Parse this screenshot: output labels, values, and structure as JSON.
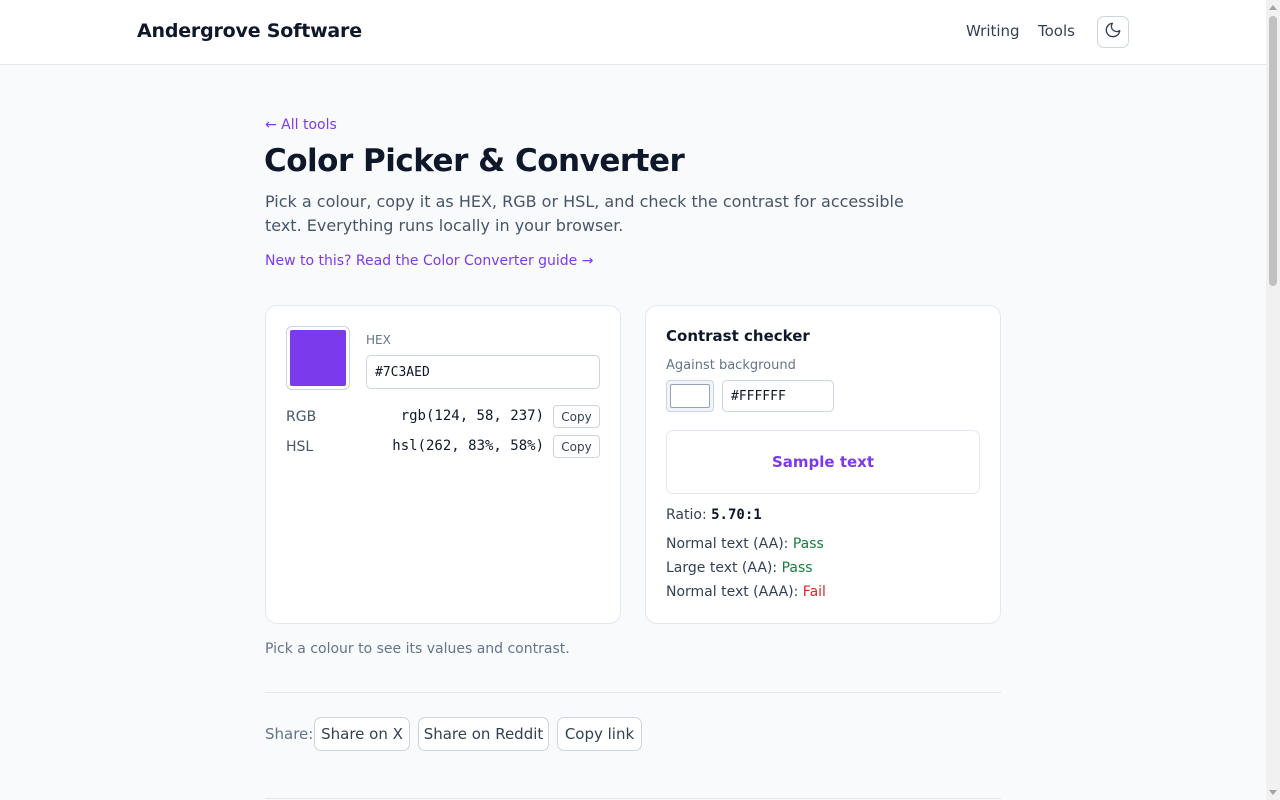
{
  "header": {
    "brand": "Andergrove Software",
    "nav": [
      "Writing",
      "Tools"
    ],
    "theme_toggle_icon": "moon-icon"
  },
  "page": {
    "back_link": "← All tools",
    "title": "Color Picker & Converter",
    "intro": "Pick a colour, copy it as HEX, RGB or HSL, and check the contrast for accessible text. Everything runs locally in your browser.",
    "guide_link": "New to this? Read the Color Converter guide →"
  },
  "picker": {
    "color": "#7C3AED",
    "hex_label": "HEX",
    "hex_value": "#7C3AED",
    "rgb_label": "RGB",
    "rgb_value": "rgb(124, 58, 237)",
    "hsl_label": "HSL",
    "hsl_value": "hsl(262, 83%, 58%)",
    "copy_label": "Copy"
  },
  "contrast": {
    "title": "Contrast checker",
    "against_label": "Against background",
    "bg_value": "#FFFFFF",
    "bg_color": "#FFFFFF",
    "sample_text": "Sample text",
    "ratio_label": "Ratio:",
    "ratio_value": "5.70:1",
    "checks": [
      {
        "label": "Normal text (AA):",
        "result": "Pass"
      },
      {
        "label": "Large text (AA):",
        "result": "Pass"
      },
      {
        "label": "Normal text (AAA):",
        "result": "Fail"
      }
    ]
  },
  "hint": "Pick a colour to see its values and contrast.",
  "share": {
    "label": "Share:",
    "buttons": [
      "Share on X",
      "Share on Reddit",
      "Copy link"
    ]
  },
  "colors": {
    "accent": "#7C3AED",
    "pass": "#15803D",
    "fail": "#DC2626"
  }
}
